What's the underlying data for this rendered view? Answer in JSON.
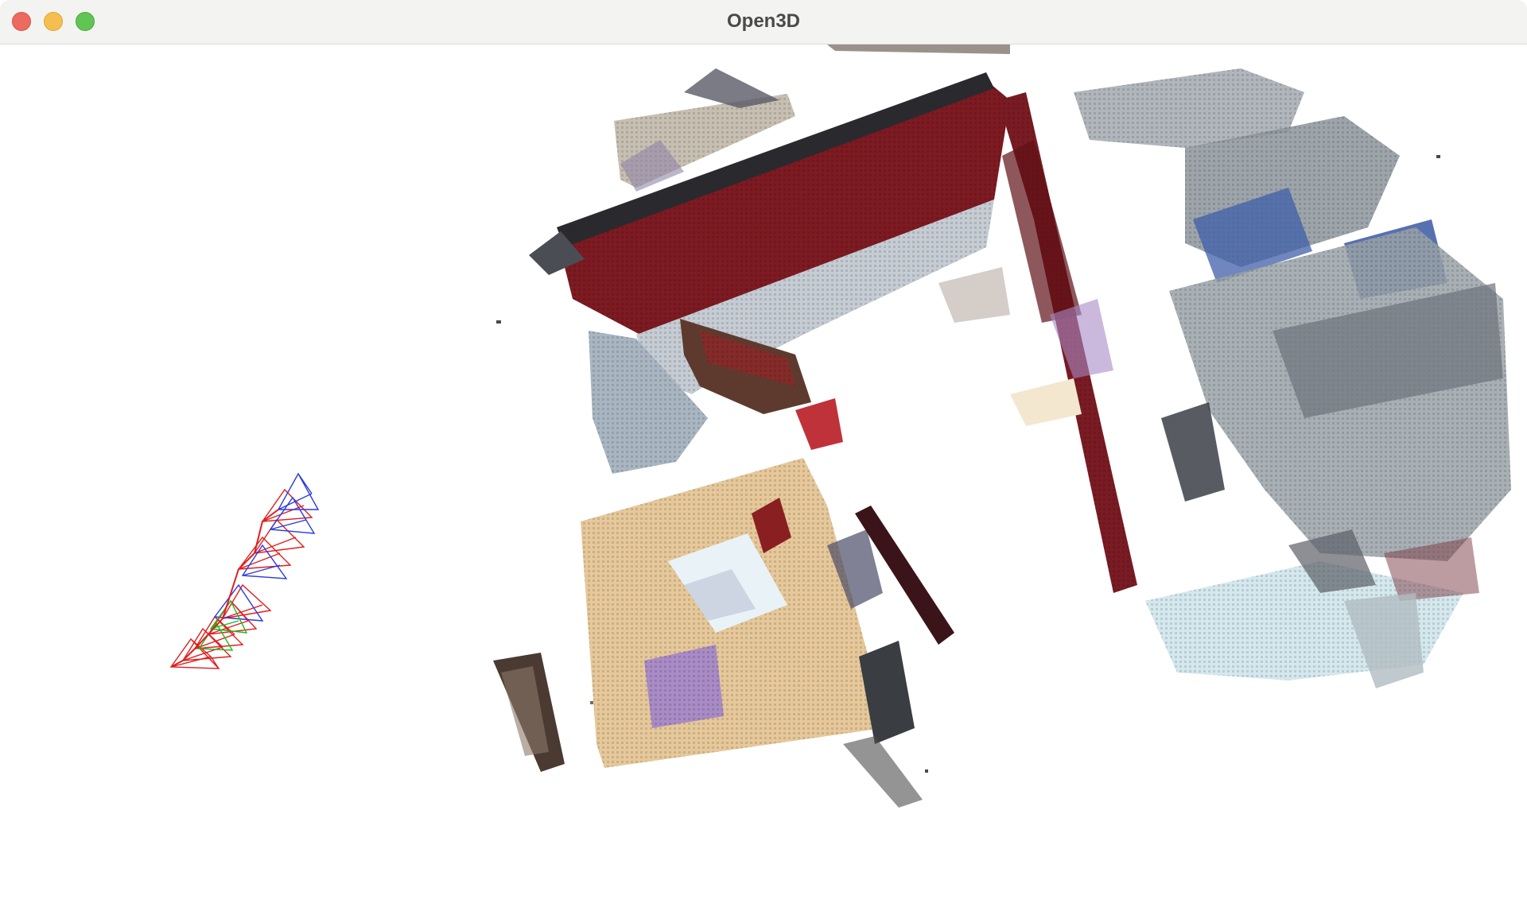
{
  "window": {
    "title": "Open3D",
    "controls": {
      "close": "close-button",
      "minimize": "minimize-button",
      "maximize": "maximize-button"
    }
  },
  "viewport": {
    "background": "#ffffff",
    "scene": {
      "point_cloud_colors": {
        "wall_red": "#7d1a22",
        "dark_red": "#5e1016",
        "wood_floor": "#e6c89a",
        "light_blue_gray": "#a9b6c2",
        "dark_gray": "#3a3d42",
        "silver": "#c5ccd3",
        "purple_book": "#a98bc6",
        "blue_accent": "#3f5fa8",
        "pale_cyan": "#cfe6ec"
      },
      "camera_frustum_colors": {
        "red": "#e01e1e",
        "blue": "#2a3be0",
        "green": "#1fb81f"
      }
    }
  }
}
